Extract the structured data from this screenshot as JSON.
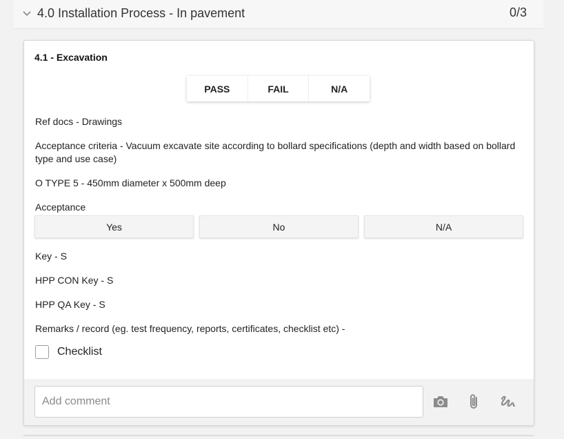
{
  "section": {
    "title": "4.0 Installation Process - In pavement",
    "count": "0/3"
  },
  "item": {
    "title": "4.1 - Excavation",
    "result_buttons": [
      "PASS",
      "FAIL",
      "N/A"
    ],
    "ref_docs": "Ref docs - Drawings",
    "acceptance_criteria": "Acceptance criteria - Vacuum excavate site according to bollard specifications (depth and width based on bollard type and use case)",
    "type_line": "O TYPE 5 - 450mm diameter x 500mm deep",
    "acceptance_label": "Acceptance",
    "acceptance_options": [
      "Yes",
      "No",
      "N/A"
    ],
    "key": "Key - S",
    "hpp_con_key": "HPP CON Key - S",
    "hpp_qa_key": "HPP QA Key - S",
    "remarks": "Remarks / record (eg. test frequency, reports, certificates, checklist etc) -",
    "checklist_label": "Checklist",
    "checklist_checked": false
  },
  "footer": {
    "comment_placeholder": "Add comment",
    "comment_value": "",
    "icons": [
      "camera-icon",
      "paperclip-icon",
      "signature-icon"
    ]
  },
  "colors": {
    "page_bg": "#f2f2f2",
    "card_bg": "#ffffff",
    "icon": "#8c8c8c"
  }
}
